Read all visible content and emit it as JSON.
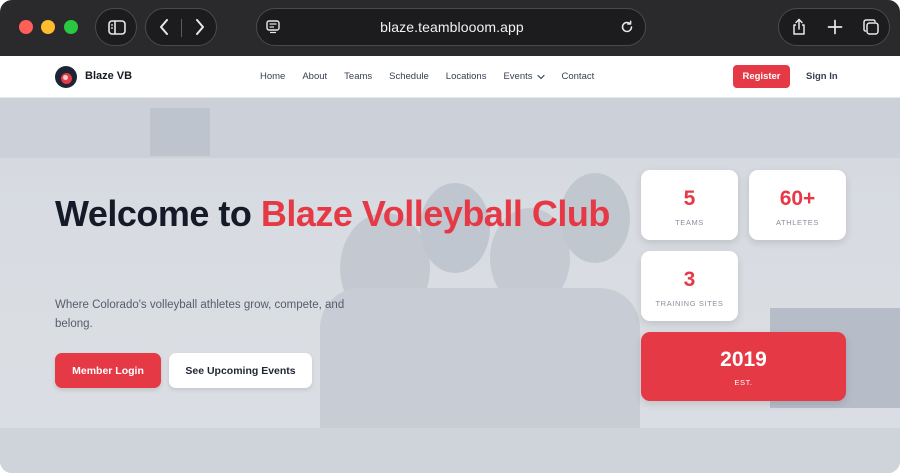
{
  "browser": {
    "url": "blaze.teamblooom.app",
    "icons": [
      "sidebar-icon",
      "back-icon",
      "forward-icon",
      "reader-icon",
      "reload-icon",
      "share-icon",
      "new-tab-icon",
      "tabs-overview-icon"
    ]
  },
  "header": {
    "brand": "Blaze VB",
    "nav": [
      "Home",
      "About",
      "Teams",
      "Schedule",
      "Locations",
      "Events",
      "Contact"
    ],
    "register": "Register",
    "sign_in": "Sign In"
  },
  "hero": {
    "title_prefix": "Welcome to ",
    "title_accent": "Blaze Volleyball Club",
    "subtitle": "Where Colorado's volleyball athletes grow, compete, and belong.",
    "primary_button": "Member Login",
    "secondary_button": "See Upcoming Events"
  },
  "stats": {
    "teams": {
      "value": "5",
      "label": "TEAMS"
    },
    "athletes": {
      "value": "60+",
      "label": "ATHLETES"
    },
    "sites": {
      "value": "3",
      "label": "TRAINING SITES"
    },
    "established": {
      "value": "2019",
      "label": "EST."
    }
  },
  "colors": {
    "accent": "#e63946",
    "chrome": "#2a2a2c",
    "heading": "#151a28"
  }
}
